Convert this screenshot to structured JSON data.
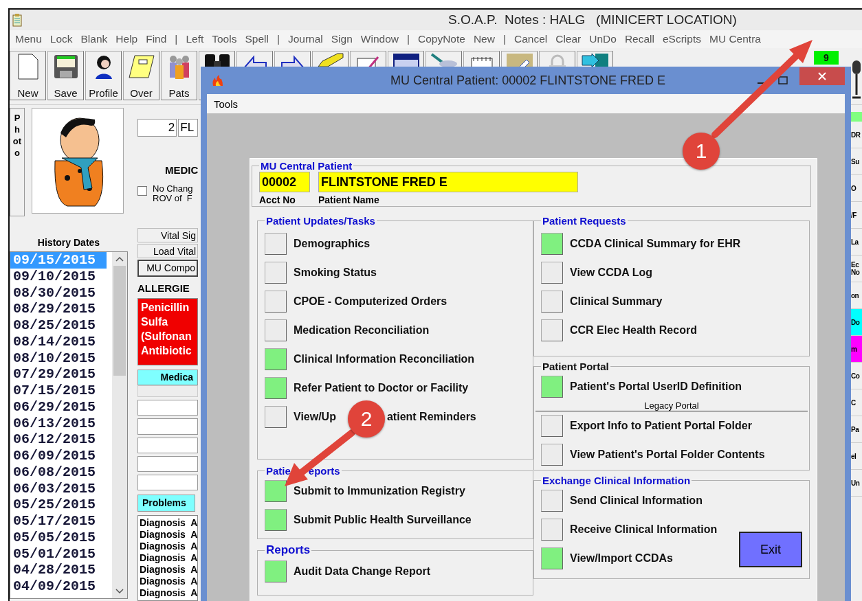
{
  "window": {
    "title": "S.O.A.P.  Notes : HALG   (MINICERT LOCATION)"
  },
  "menu": [
    "Menu",
    "Lock",
    "Blank",
    "Help",
    "Find",
    "|",
    "Left",
    "Tools",
    "Spell",
    "|",
    "Journal",
    "Sign",
    "Window",
    "|",
    "CopyNote",
    "New",
    "|",
    "Cancel",
    "Clear",
    "UnDo",
    "Recall",
    "eScripts",
    "MU Centra"
  ],
  "toolbar": {
    "buttons": [
      {
        "label": "New",
        "kind": "page"
      },
      {
        "label": "Save",
        "kind": "disk"
      },
      {
        "label": "Profile",
        "kind": "person"
      },
      {
        "label": "Over",
        "kind": "notepad"
      },
      {
        "label": "Pats",
        "kind": "people"
      },
      {
        "kind": "binoculars"
      },
      {
        "kind": "arrow-left"
      },
      {
        "kind": "arrow-right"
      },
      {
        "kind": "pencil"
      },
      {
        "kind": "note-edit"
      },
      {
        "kind": "window"
      },
      {
        "kind": "pen"
      },
      {
        "kind": "spiral"
      },
      {
        "kind": "notes"
      },
      {
        "kind": "lock"
      },
      {
        "kind": "exit"
      }
    ],
    "badge": "9"
  },
  "photo_button": "Photo",
  "history": {
    "title": "History Dates",
    "dates": [
      {
        "text": "09/15/2015",
        "selected": true
      },
      {
        "text": "09/10/2015",
        "selected": false
      },
      {
        "text": "08/30/2015",
        "selected": false
      },
      {
        "text": "08/29/2015",
        "selected": false
      },
      {
        "text": "08/25/2015",
        "selected": false
      },
      {
        "text": "08/14/2015",
        "selected": false
      },
      {
        "text": "08/10/2015",
        "selected": false
      },
      {
        "text": "07/29/2015",
        "selected": false
      },
      {
        "text": "07/15/2015",
        "selected": false
      },
      {
        "text": "06/29/2015",
        "selected": false
      },
      {
        "text": "06/13/2015",
        "selected": false
      },
      {
        "text": "06/12/2015",
        "selected": false
      },
      {
        "text": "06/09/2015",
        "selected": false
      },
      {
        "text": "06/08/2015",
        "selected": false
      },
      {
        "text": "06/03/2015",
        "selected": false
      },
      {
        "text": "05/25/2015",
        "selected": false
      },
      {
        "text": "05/17/2015",
        "selected": false
      },
      {
        "text": "05/05/2015",
        "selected": false
      },
      {
        "text": "05/01/2015",
        "selected": false
      },
      {
        "text": "04/28/2015",
        "selected": false
      },
      {
        "text": "04/09/2015",
        "selected": false
      }
    ]
  },
  "chart": {
    "acct": "2",
    "name": "FL",
    "section": "MEDIC",
    "no_change": {
      "lines": [
        "No Chang",
        "ROV of  F"
      ],
      "checked": false
    },
    "buttons": [
      "Vital Sig",
      "Load Vital",
      "MU Compo"
    ],
    "allergies_title": "ALLERGIE",
    "allergies": [
      "Penicillin",
      "Sulfa",
      "(Sulfonan",
      "Antibiotic"
    ],
    "medications_tab": "Medica",
    "problems_tab": "Problems",
    "problems": [
      "Diagnosis  A",
      "Diagnosis  A",
      "Diagnosis  A",
      "Diagnosis  A",
      "Diagnosis  A",
      "Diagnosis  A",
      "Diagnosis  A"
    ]
  },
  "right_strip": [
    {
      "text": "DR"
    },
    {
      "text": "Su"
    },
    {
      "text": "O"
    },
    {
      "text": "/F"
    },
    {
      "text": "La"
    },
    {
      "text": "Ec No"
    },
    {
      "text": "on"
    },
    {
      "text": "Do",
      "color": "#00ffff"
    },
    {
      "text": "m",
      "color": "#ff00ff"
    },
    {
      "text": "Co"
    },
    {
      "text": "C"
    },
    {
      "text": "Pa"
    },
    {
      "text": "el"
    },
    {
      "text": "Un"
    }
  ],
  "dialog": {
    "title": "MU Central Patient: 00002 FLINTSTONE FRED E",
    "menu": [
      "Tools"
    ],
    "patient": {
      "legend": "MU Central Patient",
      "acct": "00002",
      "name": "FLINTSTONE FRED E",
      "acct_label": "Acct No",
      "name_label": "Patient Name"
    },
    "left_groups": [
      {
        "title": "Patient Updates/Tasks",
        "accent": true,
        "large": false,
        "items": [
          {
            "kind": "task",
            "label": "Demographics",
            "done": false
          },
          {
            "kind": "task",
            "label": "Smoking Status",
            "done": false
          },
          {
            "kind": "task",
            "label": "CPOE - Computerized Orders",
            "done": false
          },
          {
            "kind": "task",
            "label": "Medication Reconciliation",
            "done": false
          },
          {
            "kind": "task",
            "label": "Clinical Information Reconciliation",
            "done": true
          },
          {
            "kind": "task",
            "label": "Refer Patient to Doctor or Facility",
            "done": true
          },
          {
            "kind": "task",
            "label": "View/Up",
            "label_rest": "atient Reminders",
            "done": false
          }
        ]
      },
      {
        "title": "Patie",
        "title_rest": "eports",
        "accent": true,
        "large": false,
        "items": [
          {
            "kind": "task",
            "label": "Submit to Immunization Registry",
            "done": true
          },
          {
            "kind": "task",
            "label": "Submit Public Health Surveillance",
            "done": true
          }
        ]
      },
      {
        "title": "Reports",
        "accent": true,
        "large": true,
        "items": [
          {
            "kind": "task",
            "label": "Audit Data Change Report",
            "done": true
          }
        ]
      }
    ],
    "right_groups": [
      {
        "title": "Patient Requests",
        "accent": true,
        "large": false,
        "items": [
          {
            "kind": "task",
            "label": "CCDA Clinical Summary for EHR",
            "done": true
          },
          {
            "kind": "task",
            "label": "View CCDA Log",
            "done": false
          },
          {
            "kind": "task",
            "label": "Clinical Summary",
            "done": false
          },
          {
            "kind": "task",
            "label": "CCR Elec Health Record",
            "done": false
          }
        ]
      },
      {
        "title": "Patient Portal",
        "accent": false,
        "large": false,
        "items": [
          {
            "kind": "task",
            "label": "Patient's Portal UserID Definition",
            "done": true
          },
          {
            "kind": "divider",
            "label": "Legacy Portal"
          },
          {
            "kind": "task",
            "label": "Export Info to Patient Portal Folder",
            "done": false
          },
          {
            "kind": "task",
            "label": "View Patient's Portal Folder Contents",
            "done": false
          }
        ]
      },
      {
        "title": "Exchange Clinical Information",
        "accent": true,
        "large": false,
        "items": [
          {
            "kind": "task",
            "label": "Send Clinical Information",
            "done": false
          },
          {
            "kind": "task",
            "label": "Receive Clinical Information",
            "done": false
          },
          {
            "kind": "task",
            "label": "View/Import CCDAs",
            "done": true
          }
        ]
      }
    ],
    "exit": "Exit"
  },
  "callouts": [
    "1",
    "2"
  ]
}
